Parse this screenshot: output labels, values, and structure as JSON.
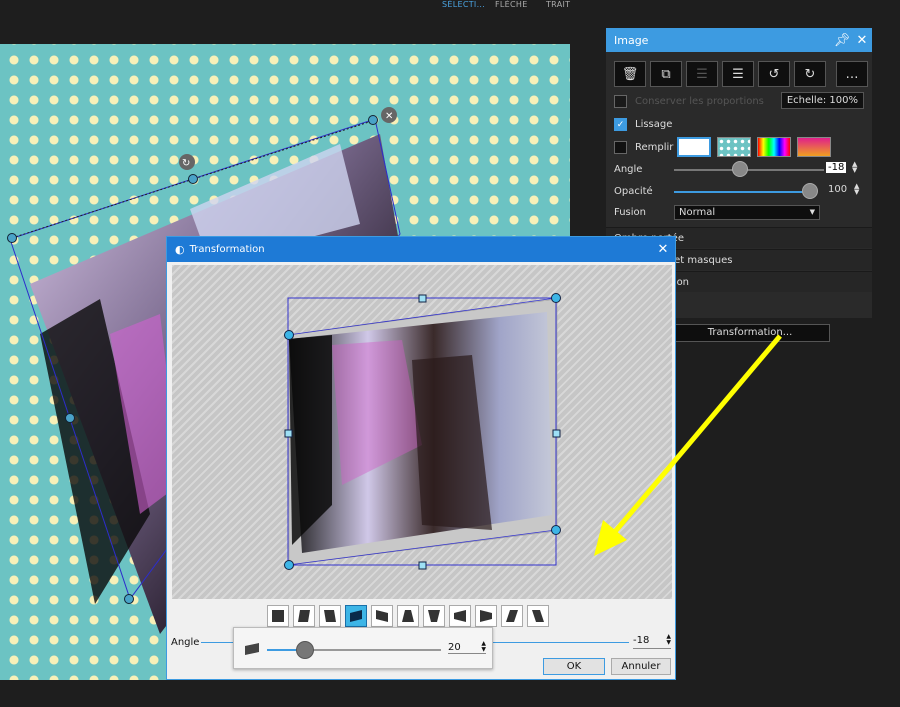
{
  "topbar": {
    "tabs": [
      {
        "label": "SÉLECTI..."
      },
      {
        "label": "FLÈCHE"
      },
      {
        "label": "TRAIT"
      }
    ]
  },
  "panel": {
    "title": "Image",
    "keep_proportions": "Conserver les proportions",
    "scale": "Echelle: 100%",
    "smoothing": "Lissage",
    "fill": "Remplir",
    "angle_label": "Angle",
    "angle_value": "-18",
    "opacity_label": "Opacité",
    "opacity_value": "100",
    "opacity_level": 1.0,
    "blend_label": "Fusion",
    "blend_value": "Normal",
    "sections": [
      {
        "label": "Ombre portée"
      },
      {
        "label": "Corrections et masques"
      },
      {
        "label": "Transformation"
      }
    ],
    "transform_button": "Transformation..."
  },
  "dialog": {
    "title": "Transformation",
    "angle_label": "Angle",
    "angle_value": "-18",
    "popup_value": "20",
    "ok": "OK",
    "cancel": "Annuler"
  },
  "colors": {
    "accent": "#3d9be1",
    "canvas": "#6cc3c3",
    "dots": "#f7f0b8",
    "arrow": "#ffff00"
  }
}
